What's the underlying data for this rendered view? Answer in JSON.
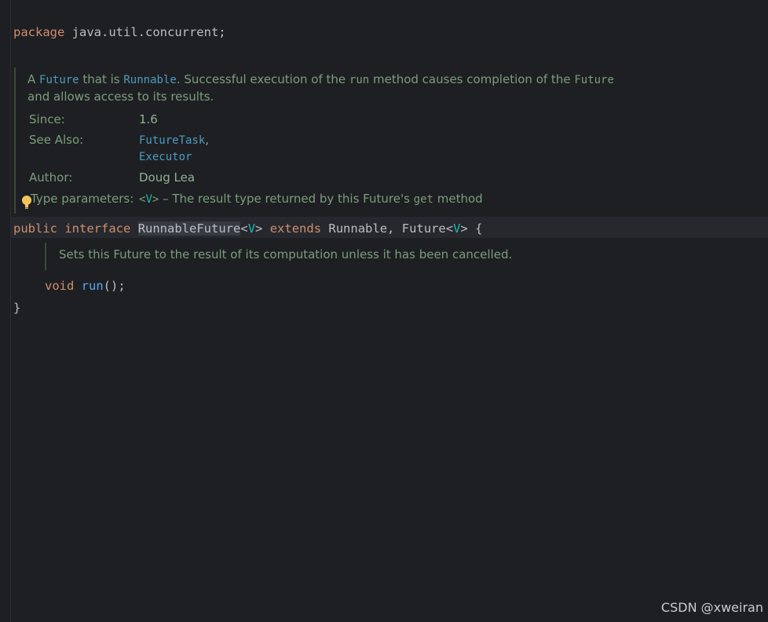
{
  "editor": {
    "package_kw": "package",
    "package_name": "java.util.concurrent;",
    "class_doc": {
      "line1_a": "A ",
      "link_future": "Future",
      "line1_b": " that is ",
      "link_runnable": "Runnable",
      "line1_c": ". Successful execution of the ",
      "code_run": "run",
      "line1_d": " method causes completion of the ",
      "code_future": "Future",
      "line2": "and allows access to its results.",
      "since_label": "Since:",
      "since_value": "1.6",
      "see_also_label": "See Also:",
      "see_also_1": "FutureTask",
      "see_also_1_suffix": ",",
      "see_also_2": "Executor",
      "author_label": "Author:",
      "author_value": "Doug Lea",
      "type_params_label": "Type parameters:",
      "type_param_open": "<",
      "type_param_name": "V",
      "type_param_close": ">",
      "type_param_desc": " – The result type returned by this Future's ",
      "type_param_code": "get",
      "type_param_tail": " method"
    },
    "decl": {
      "public_kw": "public",
      "interface_kw": "interface",
      "class_name": "RunnableFuture",
      "lt": "<",
      "type_var": "V",
      "gt": ">",
      "extends_kw": "extends",
      "super1": "Runnable,",
      "super2": "Future",
      "lt2": "<",
      "type_var2": "V",
      "gt2": ">",
      "brace_open": "{"
    },
    "method_doc": "Sets this Future to the result of its computation unless it has been cancelled.",
    "method": {
      "void_kw": "void",
      "name": "run",
      "tail": "();"
    },
    "brace_close": "}"
  },
  "watermark": "CSDN @xweiran",
  "colors": {
    "background": "#1e1f22",
    "keyword": "#cf8e6d",
    "type_param": "#16baac",
    "method": "#56a8f5",
    "doc_text": "#7a9e7e",
    "doc_link": "#4d9bc1"
  },
  "icons": [
    "lightbulb-icon"
  ]
}
